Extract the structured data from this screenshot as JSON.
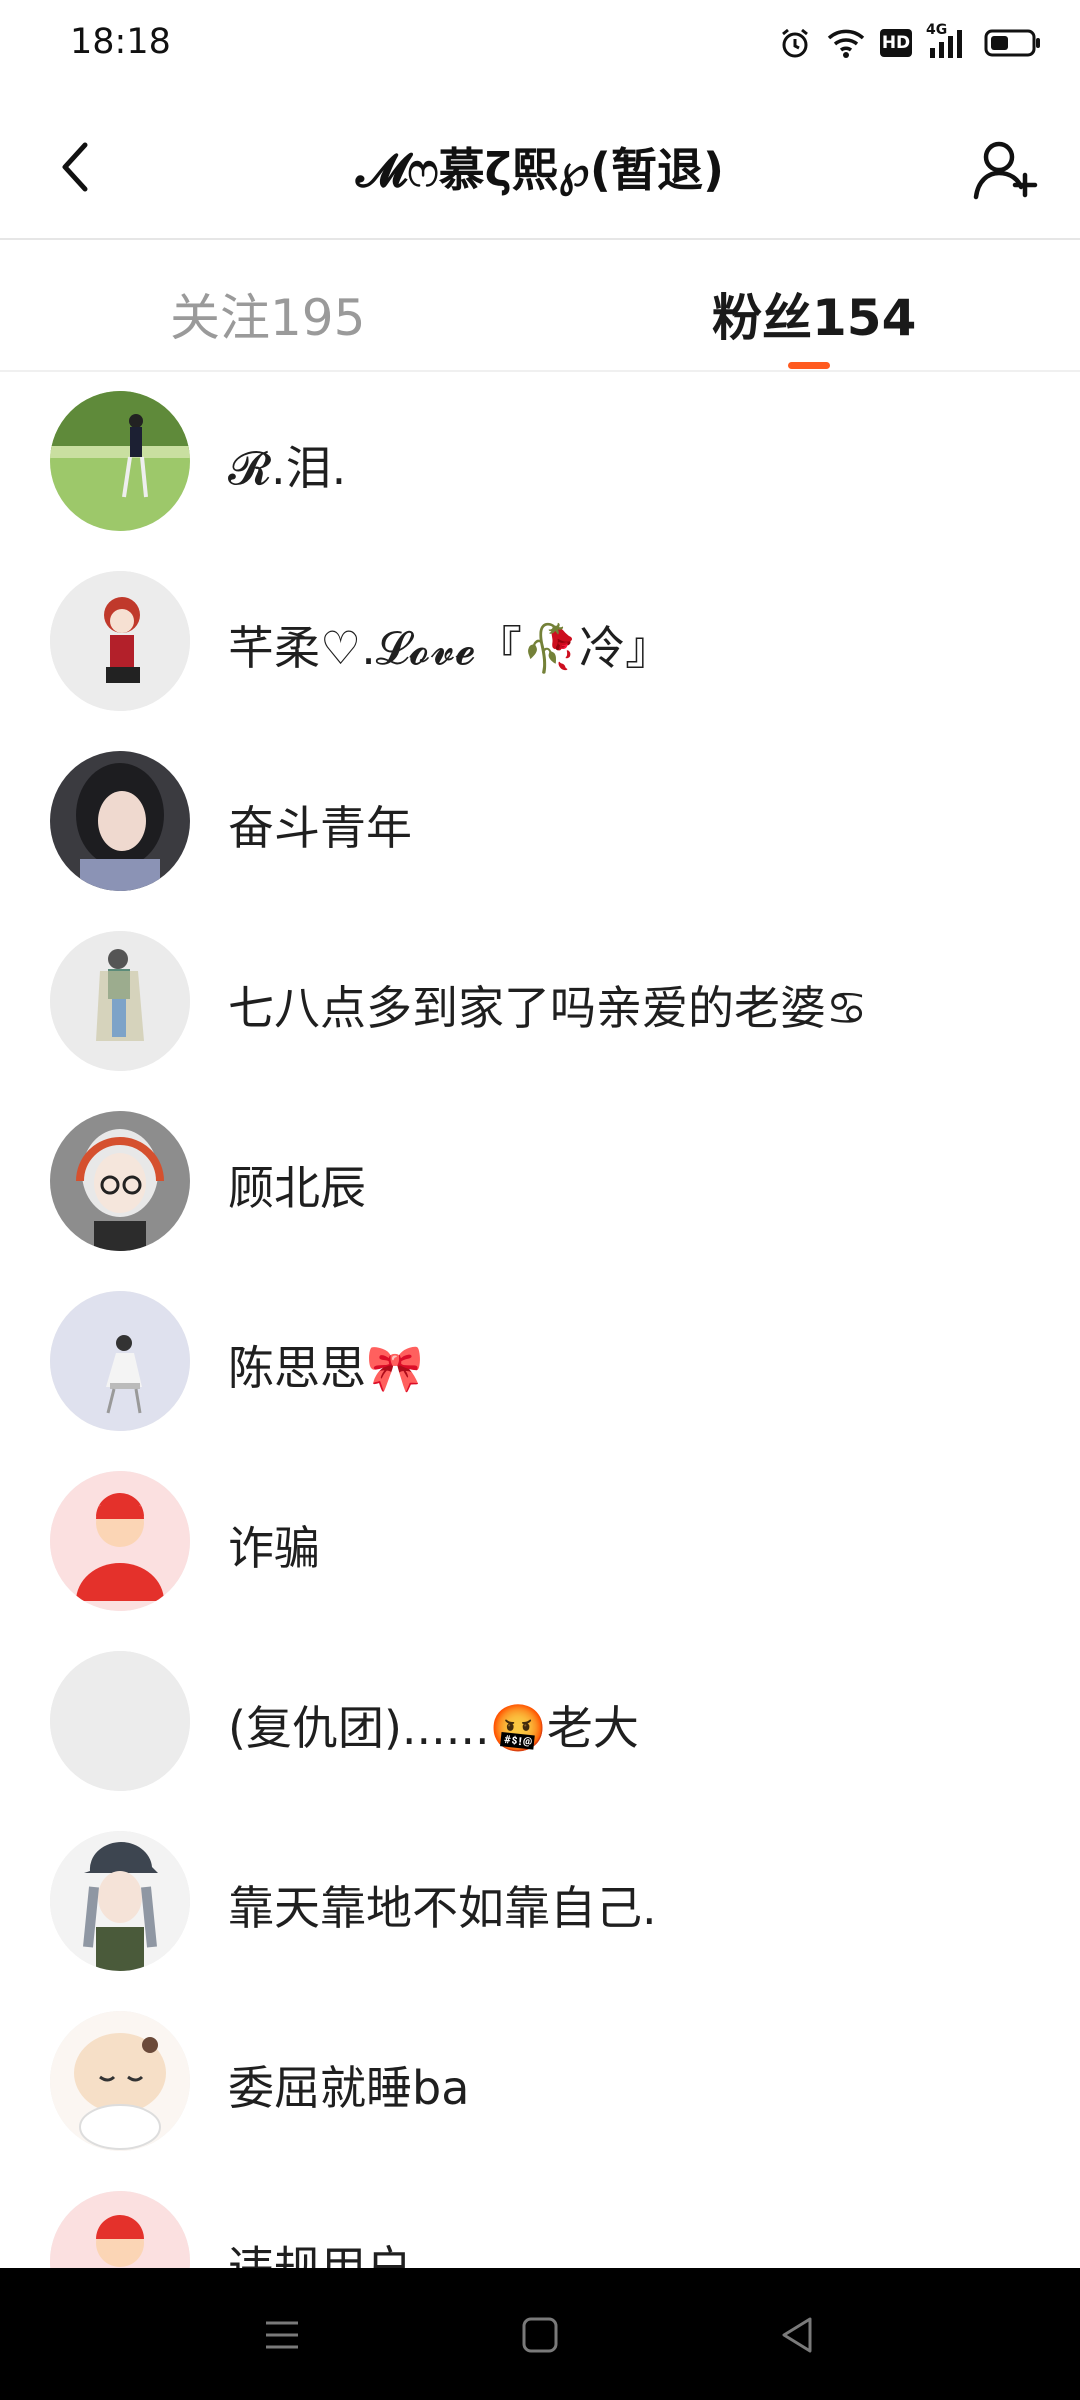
{
  "status_bar": {
    "time": "18:18",
    "icons": [
      "alarm-icon",
      "wifi-icon",
      "hd-icon",
      "signal-4g-icon",
      "battery-icon"
    ],
    "hd_label": "HD",
    "network_label": "4G"
  },
  "header": {
    "title": "𝓜ෆ慕ζ熙℘(暂退)",
    "back_icon": "chevron-left-icon",
    "add_icon": "add-friend-icon"
  },
  "tabs": {
    "following": "关注195",
    "followers": "粉丝154",
    "active": "followers",
    "accent_color": "#ff5a1f"
  },
  "followers": [
    {
      "name": "𝓡.泪.",
      "avatar": "photo-girl-in-park"
    },
    {
      "name": "芊柔♡.𝓛𝓸𝓿𝓮『🥀冷』",
      "avatar": "anime-red-hair"
    },
    {
      "name": "奋斗青年",
      "avatar": "photo-girl-dark-hair"
    },
    {
      "name": "七八点多到家了吗亲爱的老婆♋",
      "avatar": "cartoon-standing-figure"
    },
    {
      "name": "顾北辰",
      "avatar": "anime-headphones-boy"
    },
    {
      "name": "陈思思🎀",
      "avatar": "figure-sitting-chair"
    },
    {
      "name": "诈骗",
      "avatar": "default-user-red"
    },
    {
      "name": "(复仇团)......🤬老大",
      "avatar": "empty-gray"
    },
    {
      "name": "靠天靠地不如靠自己.",
      "avatar": "anime-girl-cap"
    },
    {
      "name": "委屈就睡ba",
      "avatar": "anime-sleeping-girl"
    },
    {
      "name": "违规用户",
      "avatar": "default-user-red"
    }
  ],
  "nav_bar": {
    "icons": [
      "menu-icon",
      "home-square-icon",
      "back-triangle-icon"
    ]
  }
}
